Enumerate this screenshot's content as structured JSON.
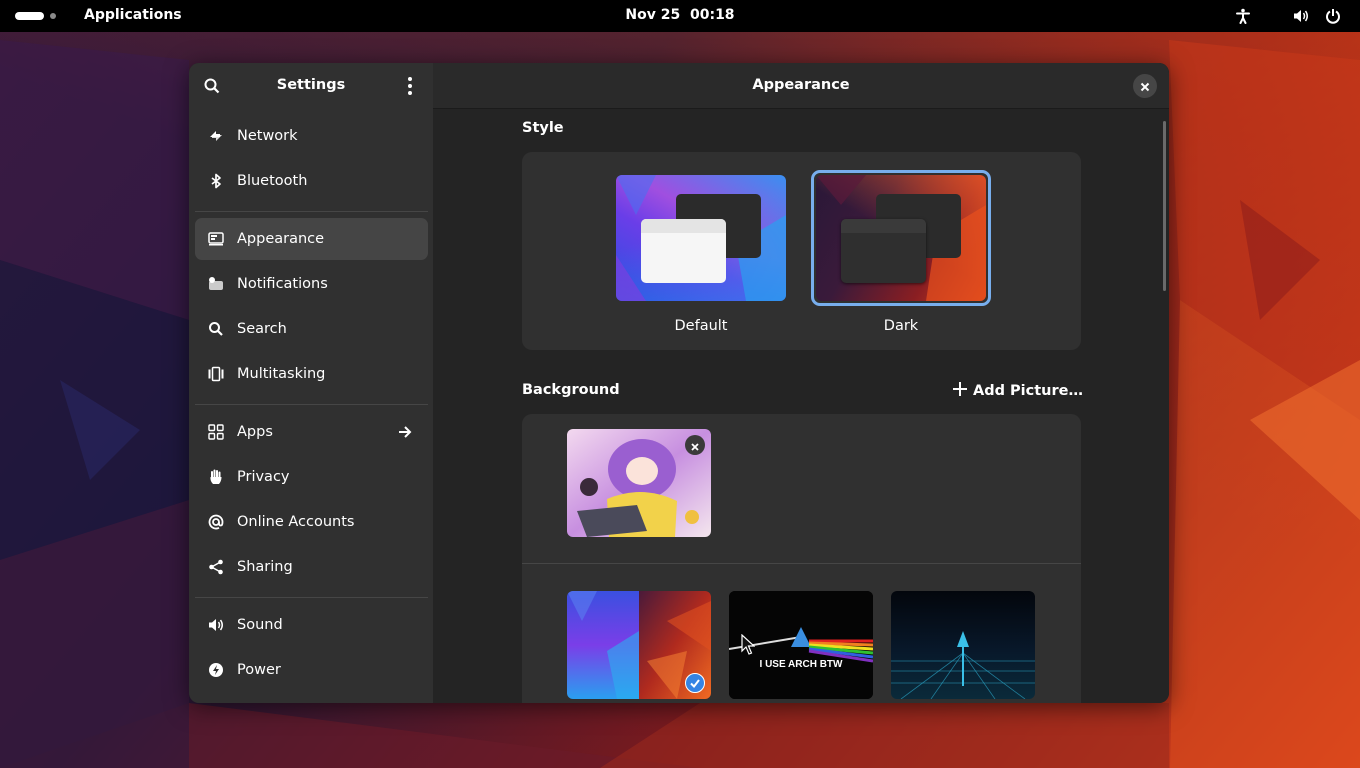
{
  "topbar": {
    "apps_label": "Applications",
    "clock": "Nov 25  00:18",
    "icons": [
      "activities-indicator",
      "accessibility-icon",
      "volume-icon",
      "power-icon"
    ]
  },
  "sidebar": {
    "title": "Settings",
    "search_icon": "search-icon",
    "menu_icon": "kebab-menu-icon",
    "items": [
      {
        "label": "Network",
        "icon": "network-icon"
      },
      {
        "label": "Bluetooth",
        "icon": "bluetooth-icon"
      },
      {
        "label": "Appearance",
        "icon": "appearance-icon",
        "selected": true
      },
      {
        "label": "Notifications",
        "icon": "notifications-icon"
      },
      {
        "label": "Search",
        "icon": "search-icon"
      },
      {
        "label": "Multitasking",
        "icon": "multitasking-icon"
      },
      {
        "label": "Apps",
        "icon": "apps-grid-icon",
        "has_arrow": true
      },
      {
        "label": "Privacy",
        "icon": "hand-icon"
      },
      {
        "label": "Online Accounts",
        "icon": "at-sign-icon"
      },
      {
        "label": "Sharing",
        "icon": "share-icon"
      },
      {
        "label": "Sound",
        "icon": "speaker-icon"
      },
      {
        "label": "Power",
        "icon": "power-bolt-icon"
      }
    ]
  },
  "content": {
    "title": "Appearance",
    "style_section": {
      "label": "Style",
      "options": [
        {
          "label": "Default",
          "selected": false
        },
        {
          "label": "Dark",
          "selected": true
        }
      ]
    },
    "background_section": {
      "label": "Background",
      "add_button": "Add Picture…",
      "wallpapers": [
        {
          "name": "anime-artwork",
          "custom": true
        },
        {
          "name": "gnome-default-split",
          "selected": true
        },
        {
          "name": "arch-prism",
          "text": "I USE ARCH BTW"
        },
        {
          "name": "arch-neon-grid"
        }
      ]
    }
  },
  "colors": {
    "accent": "#78aeed",
    "check_blue": "#3584e4",
    "sidebar_bg": "#303030",
    "content_bg": "#242424",
    "card_bg": "#303030"
  }
}
